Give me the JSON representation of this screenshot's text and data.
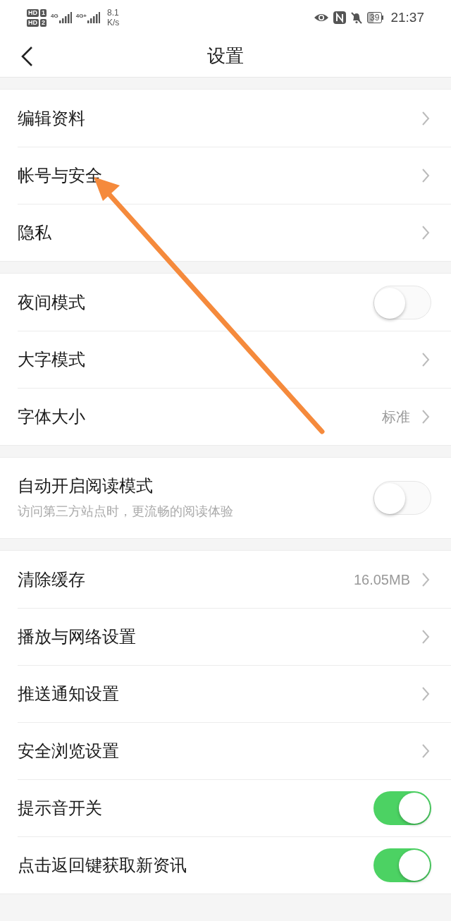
{
  "status_bar": {
    "sims": [
      {
        "label": "HD",
        "slot": "1"
      },
      {
        "label": "HD",
        "slot": "2"
      }
    ],
    "networks": [
      "4G",
      "4G+"
    ],
    "speed": "8.1",
    "speed_unit": "K/s",
    "battery": "39",
    "time": "21:37"
  },
  "header": {
    "title": "设置"
  },
  "groups": [
    {
      "rows": [
        {
          "kind": "link",
          "label": "编辑资料"
        },
        {
          "kind": "link",
          "label": "帐号与安全"
        },
        {
          "kind": "link",
          "label": "隐私"
        }
      ]
    },
    {
      "rows": [
        {
          "kind": "toggle",
          "label": "夜间模式",
          "on": false
        },
        {
          "kind": "link",
          "label": "大字模式"
        },
        {
          "kind": "link",
          "label": "字体大小",
          "value": "标准"
        }
      ]
    },
    {
      "rows": [
        {
          "kind": "toggle",
          "label": "自动开启阅读模式",
          "subtitle": "访问第三方站点时，更流畅的阅读体验",
          "on": false
        }
      ]
    },
    {
      "rows": [
        {
          "kind": "link",
          "label": "清除缓存",
          "value": "16.05MB"
        },
        {
          "kind": "link",
          "label": "播放与网络设置"
        },
        {
          "kind": "link",
          "label": "推送通知设置"
        },
        {
          "kind": "link",
          "label": "安全浏览设置"
        },
        {
          "kind": "toggle",
          "label": "提示音开关",
          "on": true
        },
        {
          "kind": "toggle",
          "label": "点击返回键获取新资讯",
          "on": true
        }
      ]
    }
  ]
}
